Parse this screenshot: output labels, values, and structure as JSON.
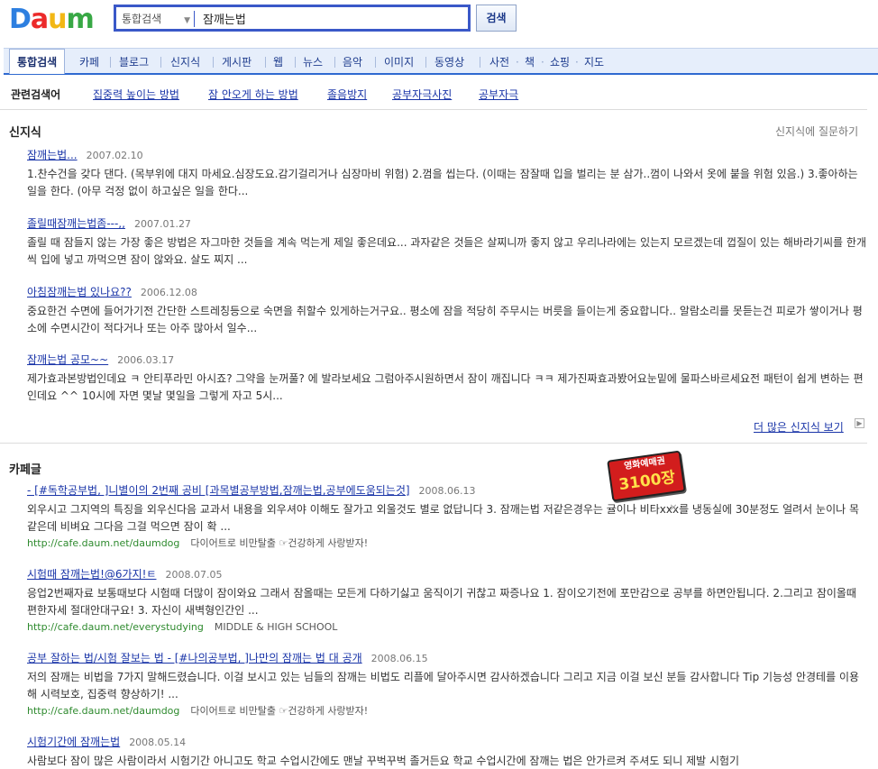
{
  "header": {
    "logo_text": [
      "D",
      "a",
      "u",
      "m"
    ],
    "search_category": "통합검색",
    "search_query": "잠깨는법",
    "search_button": "검색"
  },
  "tabs": [
    {
      "label": "통합검색",
      "active": true
    },
    {
      "label": "카페"
    },
    {
      "label": "블로그"
    },
    {
      "label": "신지식"
    },
    {
      "label": "게시판"
    },
    {
      "label": "웹"
    },
    {
      "label": "뉴스"
    },
    {
      "label": "음악"
    },
    {
      "label": "이미지"
    },
    {
      "label": "동영상"
    },
    {
      "label": "사전"
    },
    {
      "label": "책"
    },
    {
      "label": "쇼핑"
    },
    {
      "label": "지도"
    }
  ],
  "related": {
    "title": "관련검색어",
    "items": [
      "집중력 높이는 방법",
      "잠 안오게 하는 방법",
      "졸음방지",
      "공부자극사진",
      "공부자극"
    ]
  },
  "knowledge": {
    "title": "신지식",
    "ask_link": "신지식에 질문하기",
    "results": [
      {
        "title": "잠깨는법...",
        "date": "2007.02.10",
        "body": "1.찬수건을 갖다 댄다. (목부위에 대지 마세요.심장도요.감기걸리거나 심장마비 위험) 2.껌을 씹는다. (이때는 잠잘때 입을 벌리는 분 삼가..껌이 나와서 옷에 붙을 위험 있음.) 3.좋아하는 일을 한다. (아무 걱정 없이 하고싶은 일을 한다..."
      },
      {
        "title": "졸릴때잠깨는법좀---,,",
        "date": "2007.01.27",
        "body": "졸릴 때 잠들지 않는 가장 좋은 방법은 자그마한 것들을 계속 먹는게 제일 좋은데요... 과자같은 것들은 살찌니까 좋지 않고 우리나라에는 있는지 모르겠는데 껍질이 있는 해바라기씨를 한개씩 입에 넣고 까먹으면 잠이 않와요. 살도 찌지 ..."
      },
      {
        "title": "아침잠깨는법 있나요??",
        "date": "2006.12.08",
        "body": "중요한건 수면에 들어가기전 간단한 스트레칭등으로 숙면을 취할수 있게하는거구요.. 평소에 잠을 적당히 주무시는 버릇을 들이는게 중요합니다.. 알람소리를 못듣는건 피로가 쌓이거나 평소에 수면시간이 적다거나 또는 아주 많아서 일수..."
      },
      {
        "title": "잠깨는법 공모~~",
        "date": "2006.03.17",
        "body": "제가효과본방법인데요 ㅋ 안티푸라민 아시죠? 그약을 눈꺼풀? 에 발라보세요 그럼아주시원하면서 잠이 깨집니다 ㅋㅋ 제가진짜효과봤어요눈밑에 물파스바르세요전 패턴이 쉽게 변하는 편인데요 ^^ 10시에 자면 몇날 몇일을 그렇게 자고 5시..."
      }
    ],
    "more_link": "더 많은 신지식 보기"
  },
  "cafe": {
    "title": "카페글",
    "ad": {
      "line1": "영화예매권",
      "line2": "3100장",
      "close": "×"
    },
    "results": [
      {
        "title": "- [#독학공부법, ]니별이의 2번째 공비 [과목별공부방법,잠깨는법,공부에도움되는것]",
        "date": "2008.06.13",
        "body": "외우시고 그지역의 특징을 외우신다음 교과서 내용을 외우셔야 이해도 잘가고 외울것도 별로 없답니다 3. 잠깨는법 저같은경우는 귤이나 비타xxx를 냉동실에 30분정도 얼려서 눈이나 목같은데 비벼요 그다음 그걸 먹으면 잠이 확 ...",
        "url": "http://cafe.daum.net/daumdog",
        "cafe_name": "다이어트로 비만탈출 ☞건강하게 사랑받자!"
      },
      {
        "title": "시험때 잠깨는법!@6가지!ㅌ",
        "date": "2008.07.05",
        "body": "응업2번째자료 보통때보다 시험때 더많이 잠이와요 그래서 잠올때는 모든게 다하기싫고 움직이기 귀찮고 짜증나요 1. 잠이오기전에 포만감으로 공부를 하면안됩니다. 2.그리고 잠이올때 편한자세 절대안대구요! 3. 자신이 새벽형인간인 ...",
        "url": "http://cafe.daum.net/everystudying",
        "cafe_name": "MIDDLE & HIGH SCHOOL"
      },
      {
        "title": "공부 잘하는 법/시험 잘보는 법 - [#나의공부법, ]나만의 잠깨는 법 대 공개",
        "date": "2008.06.15",
        "body": "저의 잠깨는 비법을 7가지 말해드렸습니다. 이걸 보시고 있는 님들의 잠깨는 비법도 리플에 달아주시면 감사하겠습니다 그리고 지금 이걸 보신 분들 감사합니다 Tip 기능성 안경테를 이용해 시력보호, 집중력 향상하기! ...",
        "url": "http://cafe.daum.net/daumdog",
        "cafe_name": "다이어트로 비만탈출 ☞건강하게 사랑받자!"
      },
      {
        "title": "시험기간에 잠깨는법",
        "date": "2008.05.14",
        "body": "사람보다 잠이 많은 사람이라서 시험기간 아니고도 학교 수업시간에도 맨날 꾸벅꾸벅 졸거든요 학교 수업시간에 잠깨는 법은 안가르켜 주셔도 되니 제발 시험기"
      }
    ]
  }
}
